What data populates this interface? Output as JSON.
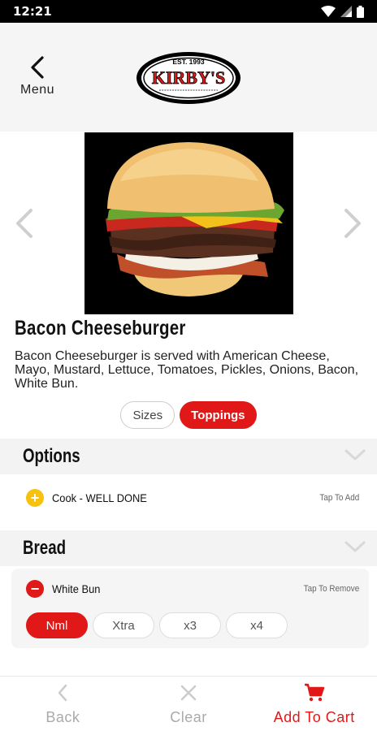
{
  "status_bar": {
    "time": "12:21"
  },
  "header": {
    "back_label": "Menu",
    "logo": {
      "est": "EST. 1993",
      "name": "KIRBY'S"
    }
  },
  "product": {
    "name": "Bacon Cheeseburger",
    "description": "Bacon Cheeseburger is served with American Cheese, Mayo, Mustard, Lettuce, Tomatoes, Pickles, Onions, Bacon, White Bun."
  },
  "tabs": [
    {
      "label": "Sizes",
      "active": false
    },
    {
      "label": "Toppings",
      "active": true
    }
  ],
  "sections": {
    "options": {
      "title": "Options",
      "items": [
        {
          "label": "Cook - WELL DONE",
          "hint": "Tap To Add"
        }
      ]
    },
    "bread": {
      "title": "Bread",
      "items": [
        {
          "label": "White Bun",
          "hint": "Tap To Remove"
        }
      ],
      "quantities": [
        "Nml",
        "Xtra",
        "x3",
        "x4"
      ],
      "selected_quantity": "Nml"
    }
  },
  "bottom_bar": {
    "back": "Back",
    "clear": "Clear",
    "add_to_cart": "Add To Cart"
  },
  "colors": {
    "accent": "#e01818",
    "add_icon": "#f6c20e",
    "section_bg": "#f3f3f3"
  }
}
